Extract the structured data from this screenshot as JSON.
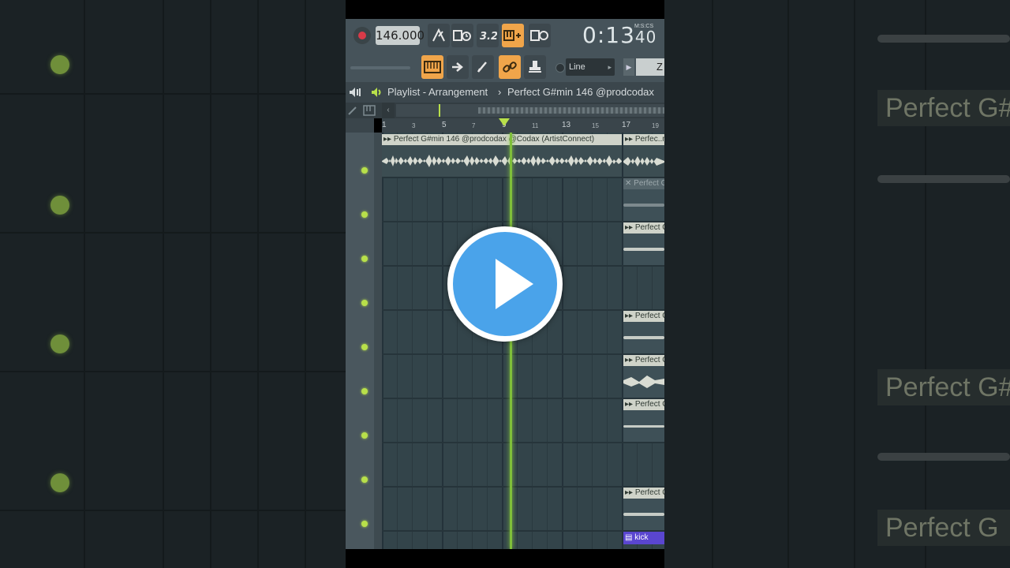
{
  "toolbar": {
    "tempo": "146.000",
    "time_main": "0:13",
    "time_sub": "40",
    "time_unit": "M:S:CS",
    "snap_value": "Line",
    "zoom_fragment": "Z"
  },
  "header": {
    "window_title": "Playlist - Arrangement",
    "separator": "›",
    "pattern_name": "Perfect G#min 146 @prodcodax"
  },
  "ruler": {
    "marks": [
      "1",
      "3",
      "5",
      "7",
      "9",
      "11",
      "13",
      "15",
      "17",
      "19"
    ]
  },
  "clips": {
    "main": "Perfect G#min 146 @prodcodax @Codax (ArtistConnect)",
    "right_top": "Perfec..nc",
    "muted": "Perfect G",
    "slice_1": "Perfect G",
    "slice_2": "Perfect G",
    "slice_3": "Perfect G",
    "slice_4": "Perfect G",
    "slice_5": "Perfect G",
    "kick": "kick"
  },
  "background": {
    "label_1": "Perfect G#",
    "label_2": "Perfect G#",
    "label_3": "Perfect G"
  },
  "colors": {
    "accent_orange": "#f0a54a",
    "playhead_green": "#7fbf3a",
    "track_led": "#b8e04a",
    "play_button_blue": "#4aa3ea",
    "kick_clip": "#5a46d0"
  }
}
